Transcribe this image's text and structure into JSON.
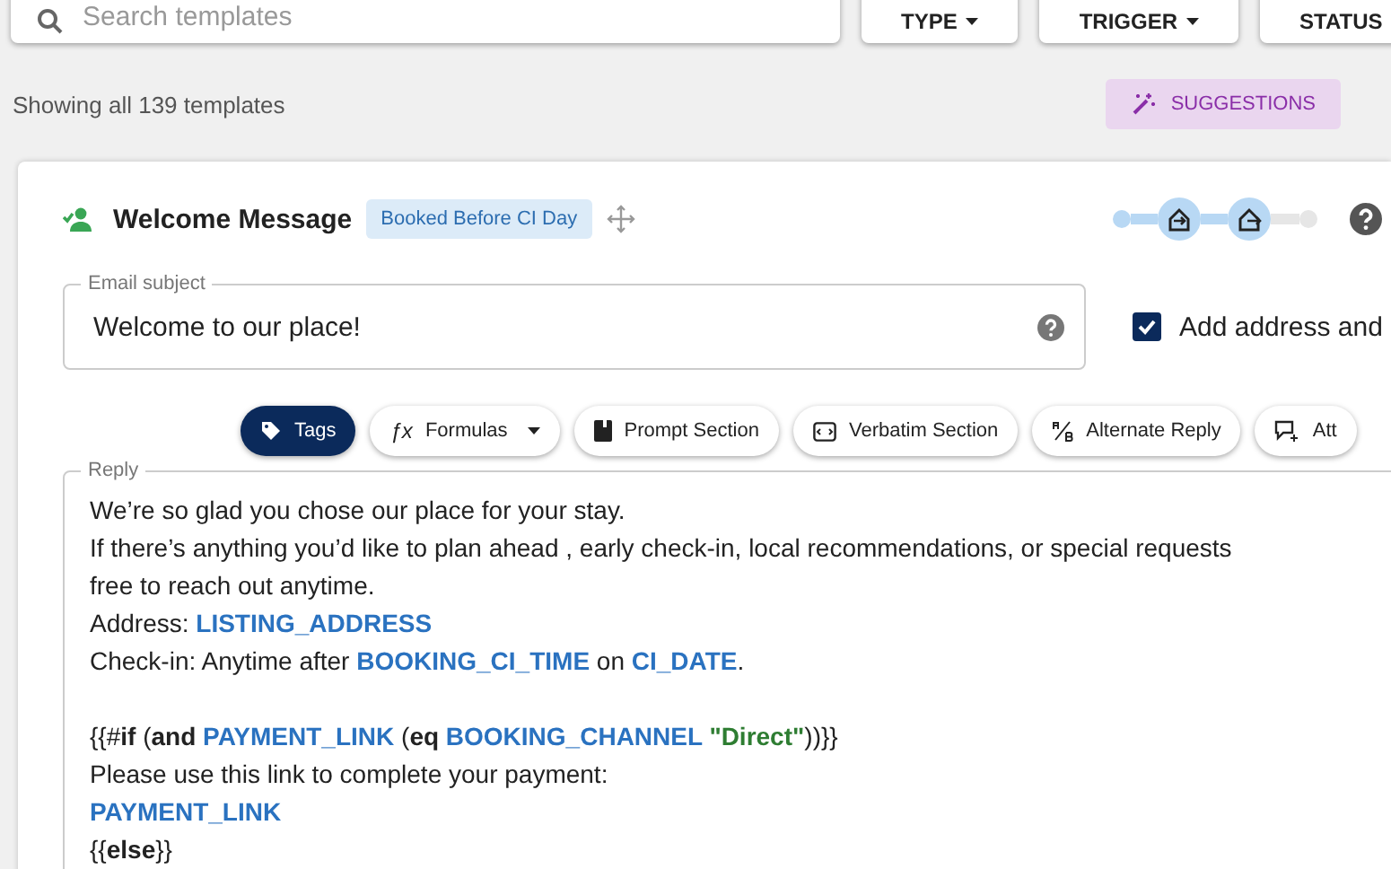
{
  "filters": {
    "search": {
      "placeholder": "Search templates"
    },
    "dropdowns": [
      "TYPE",
      "TRIGGER",
      "STATUS"
    ]
  },
  "summary": "Showing all 139 templates",
  "suggestions_button": "SUGGESTIONS",
  "template": {
    "title": "Welcome Message",
    "badge": "Booked Before CI Day",
    "stepper": {
      "steps": [
        {
          "kind": "dot",
          "done": true
        },
        {
          "kind": "check_in",
          "done": true
        },
        {
          "kind": "check_out",
          "done": true
        },
        {
          "kind": "dot",
          "done": false
        }
      ]
    },
    "subject": {
      "label": "Email subject",
      "value": "Welcome to our place!"
    },
    "add_address": {
      "label": "Add address and",
      "checked": true
    },
    "toolbar": [
      {
        "label": "Tags",
        "kind": "tag",
        "selected": true
      },
      {
        "label": "Formulas",
        "kind": "formula",
        "icon": "ƒx",
        "selected": false
      },
      {
        "label": "Prompt Section",
        "kind": "prompt",
        "selected": false
      },
      {
        "label": "Verbatim Section",
        "kind": "verbatim",
        "selected": false
      },
      {
        "label": "Alternate Reply",
        "kind": "alternate",
        "selected": false
      },
      {
        "label": "Att",
        "kind": "attach",
        "selected": false
      }
    ],
    "reply": {
      "label": "Reply",
      "lines": [
        {
          "kind": "text",
          "segments": [
            {
              "kind": "text",
              "text": "We’re so glad you chose our place for your stay."
            }
          ]
        },
        {
          "kind": "text",
          "segments": [
            {
              "kind": "text",
              "text": "If there’s anything you’d like to plan ahead , early check-in, local recommendations, or special requests"
            }
          ]
        },
        {
          "kind": "text",
          "segments": [
            {
              "kind": "text",
              "text": "free to reach out anytime."
            }
          ]
        },
        {
          "kind": "text",
          "segments": [
            {
              "kind": "text",
              "text": " Address: "
            },
            {
              "kind": "var",
              "text": "LISTING_ADDRESS"
            }
          ]
        },
        {
          "kind": "text",
          "segments": [
            {
              "kind": "text",
              "text": "Check-in: Anytime after "
            },
            {
              "kind": "var",
              "text": "BOOKING_CI_TIME"
            },
            {
              "kind": "text",
              "text": " on "
            },
            {
              "kind": "var",
              "text": "CI_DATE"
            },
            {
              "kind": "text",
              "text": "."
            }
          ]
        },
        {
          "kind": "blank"
        },
        {
          "kind": "text",
          "segments": [
            {
              "kind": "text",
              "text": "{{#"
            },
            {
              "kind": "keyword",
              "text": "if"
            },
            {
              "kind": "text",
              "text": " ("
            },
            {
              "kind": "keyword",
              "text": "and "
            },
            {
              "kind": "var",
              "text": "PAYMENT_LINK"
            },
            {
              "kind": "text",
              "text": " ("
            },
            {
              "kind": "keyword",
              "text": "eq "
            },
            {
              "kind": "var",
              "text": "BOOKING_CHANNEL "
            },
            {
              "kind": "string",
              "text": "\"Direct\""
            },
            {
              "kind": "text",
              "text": "))}}"
            }
          ]
        },
        {
          "kind": "text",
          "segments": [
            {
              "kind": "text",
              "text": "Please use this link to complete your payment:"
            }
          ]
        },
        {
          "kind": "text",
          "segments": [
            {
              "kind": "var",
              "text": "PAYMENT_LINK"
            }
          ]
        },
        {
          "kind": "text",
          "segments": [
            {
              "kind": "text",
              "text": "{{"
            },
            {
              "kind": "keyword",
              "text": "else"
            },
            {
              "kind": "text",
              "text": "}}"
            }
          ]
        }
      ]
    }
  }
}
